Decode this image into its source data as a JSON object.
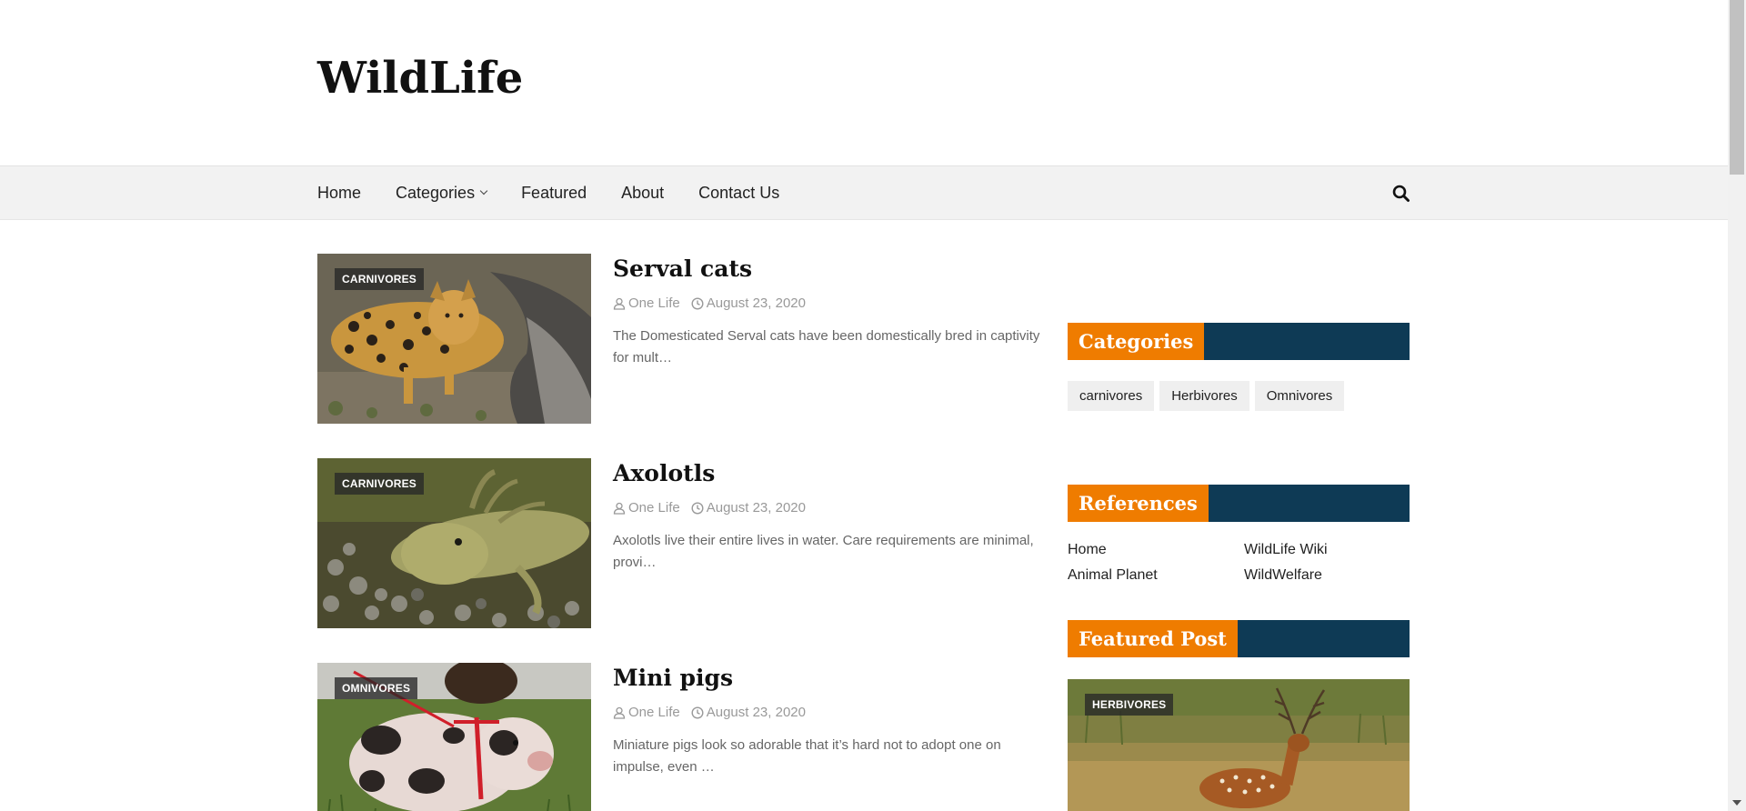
{
  "site": {
    "title": "WildLife"
  },
  "nav": {
    "items": [
      {
        "label": "Home"
      },
      {
        "label": "Categories",
        "has_dropdown": true
      },
      {
        "label": "Featured"
      },
      {
        "label": "About"
      },
      {
        "label": "Contact Us"
      }
    ],
    "search_icon": "search-icon"
  },
  "posts": [
    {
      "category": "CARNIVORES",
      "title": "Serval cats",
      "author": "One Life",
      "date": "August 23, 2020",
      "excerpt": "The Domesticated Serval cats have been domestically bred  in captivity for mult…"
    },
    {
      "category": "CARNIVORES",
      "title": "Axolotls",
      "author": "One Life",
      "date": "August 23, 2020",
      "excerpt": "Axolotls live their entire lives in water. Care requirements are minimal, provi…"
    },
    {
      "category": "OMNIVORES",
      "title": "Mini pigs",
      "author": "One Life",
      "date": "August 23, 2020",
      "excerpt": "Miniature pigs look so adorable that it’s hard not to adopt one on impulse, even …"
    }
  ],
  "sidebar": {
    "categories": {
      "title": "Categories",
      "tags": [
        "carnivores",
        "Herbivores",
        "Omnivores"
      ]
    },
    "references": {
      "title": "References",
      "links": [
        "Home",
        "WildLife Wiki",
        "Animal Planet",
        "WildWelfare"
      ]
    },
    "featured_post": {
      "title": "Featured Post",
      "category": "HERBIVORES"
    }
  },
  "colors": {
    "accent_orange": "#ef7c00",
    "widget_navy": "#0e3a55",
    "nav_bg": "#f2f2f2"
  }
}
